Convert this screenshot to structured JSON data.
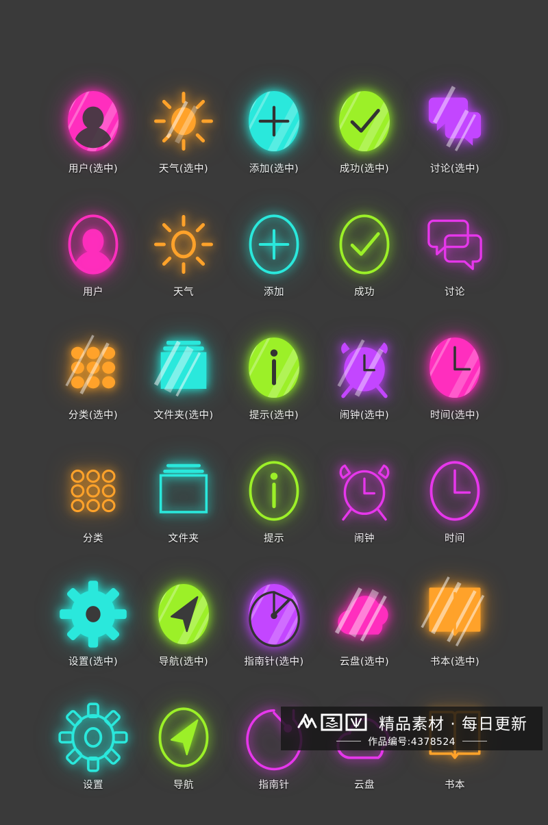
{
  "page": {
    "background_color": "#3a3a3a",
    "label_color": "#f2f2f2",
    "columns": 5,
    "rows": 6
  },
  "palette": {
    "pink": "#ff2ebe",
    "orange": "#ffa22a",
    "cyan": "#2ae8dc",
    "green": "#9cf028",
    "purple": "#c346ff",
    "magenta": "#e637eb"
  },
  "icons": [
    {
      "label": "用户(选中)",
      "icon_name": "user-icon",
      "state": "selected",
      "color": "pink",
      "glow": "g-pink"
    },
    {
      "label": "天气(选中)",
      "icon_name": "sun-icon",
      "state": "selected",
      "color": "orange",
      "glow": "g-orange"
    },
    {
      "label": "添加(选中)",
      "icon_name": "plus-icon",
      "state": "selected",
      "color": "cyan",
      "glow": "g-cyan"
    },
    {
      "label": "成功(选中)",
      "icon_name": "check-icon",
      "state": "selected",
      "color": "green",
      "glow": "g-green"
    },
    {
      "label": "讨论(选中)",
      "icon_name": "chat-icon",
      "state": "selected",
      "color": "purple",
      "glow": "g-purple"
    },
    {
      "label": "用户",
      "icon_name": "user-icon",
      "state": "unselected",
      "color": "pink",
      "glow": "g-pink"
    },
    {
      "label": "天气",
      "icon_name": "sun-icon",
      "state": "unselected",
      "color": "orange",
      "glow": "g-orange"
    },
    {
      "label": "添加",
      "icon_name": "plus-icon",
      "state": "unselected",
      "color": "cyan",
      "glow": "g-cyan"
    },
    {
      "label": "成功",
      "icon_name": "check-icon",
      "state": "unselected",
      "color": "green",
      "glow": "g-green"
    },
    {
      "label": "讨论",
      "icon_name": "chat-icon",
      "state": "unselected",
      "color": "magenta",
      "glow": "g-magenta"
    },
    {
      "label": "分类(选中)",
      "icon_name": "grid-icon",
      "state": "selected",
      "color": "orange",
      "glow": "g-orange"
    },
    {
      "label": "文件夹(选中)",
      "icon_name": "folder-icon",
      "state": "selected",
      "color": "cyan",
      "glow": "g-cyan"
    },
    {
      "label": "提示(选中)",
      "icon_name": "info-icon",
      "state": "selected",
      "color": "green",
      "glow": "g-green"
    },
    {
      "label": "闹钟(选中)",
      "icon_name": "alarm-icon",
      "state": "selected",
      "color": "purple",
      "glow": "g-purple"
    },
    {
      "label": "时间(选中)",
      "icon_name": "clock-icon",
      "state": "selected",
      "color": "pink",
      "glow": "g-pink"
    },
    {
      "label": "分类",
      "icon_name": "grid-icon",
      "state": "unselected",
      "color": "orange",
      "glow": "g-orange"
    },
    {
      "label": "文件夹",
      "icon_name": "folder-icon",
      "state": "unselected",
      "color": "cyan",
      "glow": "g-cyan"
    },
    {
      "label": "提示",
      "icon_name": "info-icon",
      "state": "unselected",
      "color": "green",
      "glow": "g-green"
    },
    {
      "label": "闹钟",
      "icon_name": "alarm-icon",
      "state": "unselected",
      "color": "magenta",
      "glow": "g-magenta"
    },
    {
      "label": "时间",
      "icon_name": "clock-icon",
      "state": "unselected",
      "color": "magenta",
      "glow": "g-magenta"
    },
    {
      "label": "设置(选中)",
      "icon_name": "gear-icon",
      "state": "selected",
      "color": "cyan",
      "glow": "g-cyan"
    },
    {
      "label": "导航(选中)",
      "icon_name": "navigate-icon",
      "state": "selected",
      "color": "green",
      "glow": "g-green"
    },
    {
      "label": "指南针(选中)",
      "icon_name": "compass-icon",
      "state": "selected",
      "color": "purple",
      "glow": "g-purple"
    },
    {
      "label": "云盘(选中)",
      "icon_name": "cloud-icon",
      "state": "selected",
      "color": "pink",
      "glow": "g-pink"
    },
    {
      "label": "书本(选中)",
      "icon_name": "book-icon",
      "state": "selected",
      "color": "orange",
      "glow": "g-orange"
    },
    {
      "label": "设置",
      "icon_name": "gear-icon",
      "state": "unselected",
      "color": "cyan",
      "glow": "g-cyan"
    },
    {
      "label": "导航",
      "icon_name": "navigate-icon",
      "state": "unselected",
      "color": "green",
      "glow": "g-green"
    },
    {
      "label": "指南针",
      "icon_name": "compass-icon",
      "state": "unselected",
      "color": "magenta",
      "glow": "g-magenta"
    },
    {
      "label": "云盘",
      "icon_name": "cloud-icon",
      "state": "unselected",
      "color": "magenta",
      "glow": "g-magenta"
    },
    {
      "label": "书本",
      "icon_name": "book-icon",
      "state": "unselected",
      "color": "orange",
      "glow": "g-orange"
    }
  ],
  "watermark": {
    "logo_text": "众图网",
    "tagline": "精品素材 · 每日更新",
    "work_id": "作品编号:4378524"
  }
}
